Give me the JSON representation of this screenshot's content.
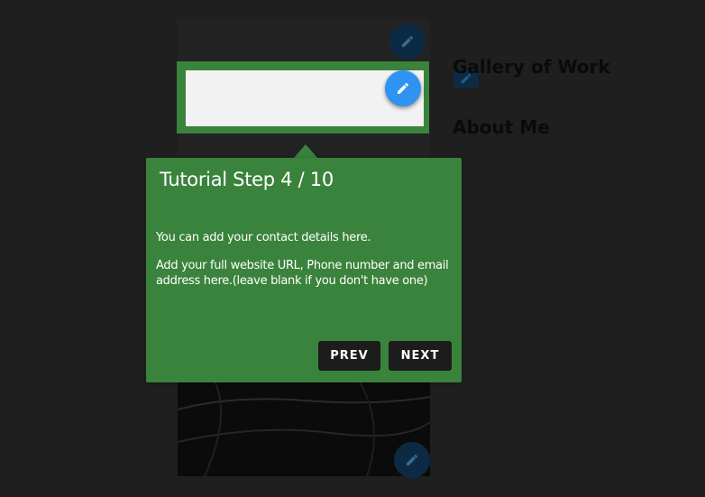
{
  "page": {
    "headings": [
      "Gallery of Work",
      "About Me"
    ]
  },
  "tutorial": {
    "title": "Tutorial Step 4 / 10",
    "body": [
      "You can add your contact details here.",
      "Add your full website URL, Phone number and email address here.(leave blank if you don't have one)"
    ],
    "prev_label": "PREV",
    "next_label": "NEXT"
  },
  "icons": {
    "edit": "pencil-icon"
  },
  "colors": {
    "highlight": "#3a833c",
    "fab": "#2f93f1",
    "button": "#1c1c1c",
    "backdrop": "#1f1f1f"
  }
}
